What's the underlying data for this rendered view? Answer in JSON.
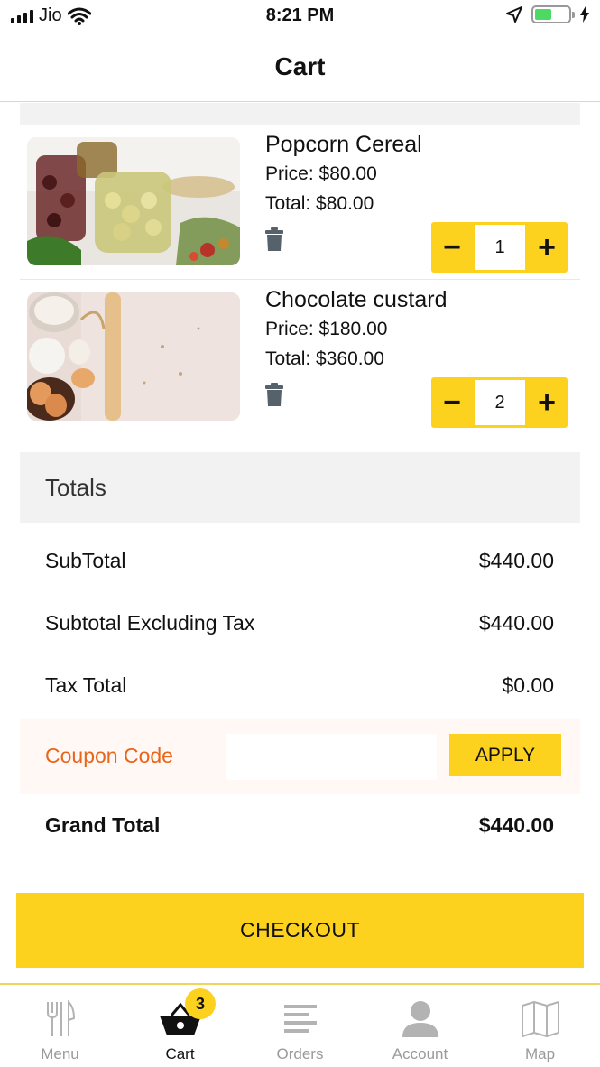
{
  "status_bar": {
    "carrier": "Jio",
    "time": "8:21 PM"
  },
  "header": {
    "title": "Cart"
  },
  "cart": {
    "items": [
      {
        "name": "Popcorn Cereal",
        "price": "Price: $80.00",
        "total": "Total: $80.00",
        "quantity": "1",
        "minus_label": "−",
        "plus_label": "+",
        "image_icon": "jars-of-olives-image"
      },
      {
        "name": "Chocolate custard",
        "price": "Price: $180.00",
        "total": "Total: $360.00",
        "quantity": "2",
        "minus_label": "−",
        "plus_label": "+",
        "image_icon": "baking-ingredients-image"
      }
    ]
  },
  "totals": {
    "heading": "Totals",
    "subtotal_label": "SubTotal",
    "subtotal_value": "$440.00",
    "subtotal_ex_label": "Subtotal Excluding Tax",
    "subtotal_ex_value": "$440.00",
    "tax_label": "Tax Total",
    "tax_value": "$0.00",
    "grand_label": "Grand Total",
    "grand_value": "$440.00"
  },
  "coupon": {
    "label": "Coupon Code",
    "value": "",
    "apply_label": "APPLY"
  },
  "checkout_label": "CHECKOUT",
  "tabbar": {
    "tabs": [
      {
        "label": "Menu",
        "icon": "fork-knife-icon"
      },
      {
        "label": "Cart",
        "icon": "basket-icon",
        "badge": "3"
      },
      {
        "label": "Orders",
        "icon": "list-icon"
      },
      {
        "label": "Account",
        "icon": "person-icon"
      },
      {
        "label": "Map",
        "icon": "map-icon"
      }
    ],
    "active": "Cart"
  },
  "colors": {
    "accent": "#fdd21f",
    "coupon_label": "#e8651a",
    "battery": "#4cd964"
  }
}
